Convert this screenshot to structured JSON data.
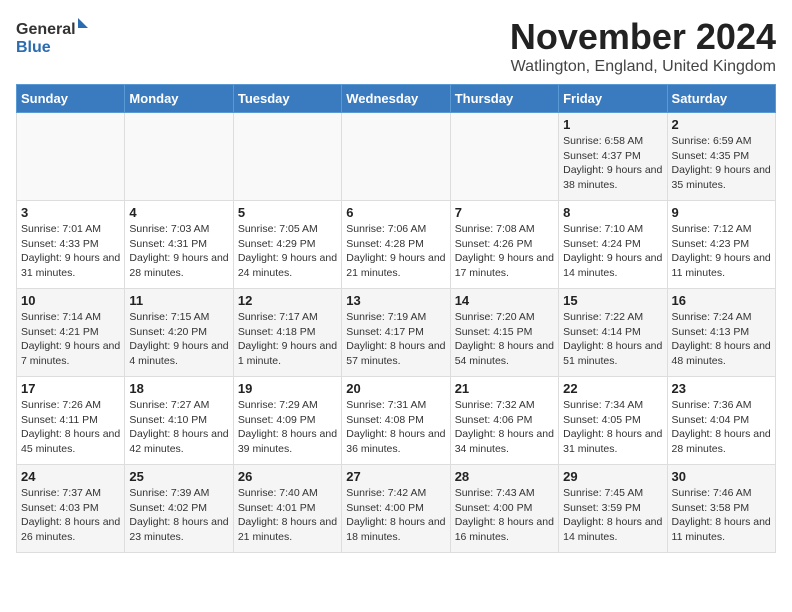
{
  "header": {
    "logo_general": "General",
    "logo_blue": "Blue",
    "month_title": "November 2024",
    "location": "Watlington, England, United Kingdom"
  },
  "days_of_week": [
    "Sunday",
    "Monday",
    "Tuesday",
    "Wednesday",
    "Thursday",
    "Friday",
    "Saturday"
  ],
  "weeks": [
    [
      {
        "day": "",
        "info": ""
      },
      {
        "day": "",
        "info": ""
      },
      {
        "day": "",
        "info": ""
      },
      {
        "day": "",
        "info": ""
      },
      {
        "day": "",
        "info": ""
      },
      {
        "day": "1",
        "info": "Sunrise: 6:58 AM\nSunset: 4:37 PM\nDaylight: 9 hours and 38 minutes."
      },
      {
        "day": "2",
        "info": "Sunrise: 6:59 AM\nSunset: 4:35 PM\nDaylight: 9 hours and 35 minutes."
      }
    ],
    [
      {
        "day": "3",
        "info": "Sunrise: 7:01 AM\nSunset: 4:33 PM\nDaylight: 9 hours and 31 minutes."
      },
      {
        "day": "4",
        "info": "Sunrise: 7:03 AM\nSunset: 4:31 PM\nDaylight: 9 hours and 28 minutes."
      },
      {
        "day": "5",
        "info": "Sunrise: 7:05 AM\nSunset: 4:29 PM\nDaylight: 9 hours and 24 minutes."
      },
      {
        "day": "6",
        "info": "Sunrise: 7:06 AM\nSunset: 4:28 PM\nDaylight: 9 hours and 21 minutes."
      },
      {
        "day": "7",
        "info": "Sunrise: 7:08 AM\nSunset: 4:26 PM\nDaylight: 9 hours and 17 minutes."
      },
      {
        "day": "8",
        "info": "Sunrise: 7:10 AM\nSunset: 4:24 PM\nDaylight: 9 hours and 14 minutes."
      },
      {
        "day": "9",
        "info": "Sunrise: 7:12 AM\nSunset: 4:23 PM\nDaylight: 9 hours and 11 minutes."
      }
    ],
    [
      {
        "day": "10",
        "info": "Sunrise: 7:14 AM\nSunset: 4:21 PM\nDaylight: 9 hours and 7 minutes."
      },
      {
        "day": "11",
        "info": "Sunrise: 7:15 AM\nSunset: 4:20 PM\nDaylight: 9 hours and 4 minutes."
      },
      {
        "day": "12",
        "info": "Sunrise: 7:17 AM\nSunset: 4:18 PM\nDaylight: 9 hours and 1 minute."
      },
      {
        "day": "13",
        "info": "Sunrise: 7:19 AM\nSunset: 4:17 PM\nDaylight: 8 hours and 57 minutes."
      },
      {
        "day": "14",
        "info": "Sunrise: 7:20 AM\nSunset: 4:15 PM\nDaylight: 8 hours and 54 minutes."
      },
      {
        "day": "15",
        "info": "Sunrise: 7:22 AM\nSunset: 4:14 PM\nDaylight: 8 hours and 51 minutes."
      },
      {
        "day": "16",
        "info": "Sunrise: 7:24 AM\nSunset: 4:13 PM\nDaylight: 8 hours and 48 minutes."
      }
    ],
    [
      {
        "day": "17",
        "info": "Sunrise: 7:26 AM\nSunset: 4:11 PM\nDaylight: 8 hours and 45 minutes."
      },
      {
        "day": "18",
        "info": "Sunrise: 7:27 AM\nSunset: 4:10 PM\nDaylight: 8 hours and 42 minutes."
      },
      {
        "day": "19",
        "info": "Sunrise: 7:29 AM\nSunset: 4:09 PM\nDaylight: 8 hours and 39 minutes."
      },
      {
        "day": "20",
        "info": "Sunrise: 7:31 AM\nSunset: 4:08 PM\nDaylight: 8 hours and 36 minutes."
      },
      {
        "day": "21",
        "info": "Sunrise: 7:32 AM\nSunset: 4:06 PM\nDaylight: 8 hours and 34 minutes."
      },
      {
        "day": "22",
        "info": "Sunrise: 7:34 AM\nSunset: 4:05 PM\nDaylight: 8 hours and 31 minutes."
      },
      {
        "day": "23",
        "info": "Sunrise: 7:36 AM\nSunset: 4:04 PM\nDaylight: 8 hours and 28 minutes."
      }
    ],
    [
      {
        "day": "24",
        "info": "Sunrise: 7:37 AM\nSunset: 4:03 PM\nDaylight: 8 hours and 26 minutes."
      },
      {
        "day": "25",
        "info": "Sunrise: 7:39 AM\nSunset: 4:02 PM\nDaylight: 8 hours and 23 minutes."
      },
      {
        "day": "26",
        "info": "Sunrise: 7:40 AM\nSunset: 4:01 PM\nDaylight: 8 hours and 21 minutes."
      },
      {
        "day": "27",
        "info": "Sunrise: 7:42 AM\nSunset: 4:00 PM\nDaylight: 8 hours and 18 minutes."
      },
      {
        "day": "28",
        "info": "Sunrise: 7:43 AM\nSunset: 4:00 PM\nDaylight: 8 hours and 16 minutes."
      },
      {
        "day": "29",
        "info": "Sunrise: 7:45 AM\nSunset: 3:59 PM\nDaylight: 8 hours and 14 minutes."
      },
      {
        "day": "30",
        "info": "Sunrise: 7:46 AM\nSunset: 3:58 PM\nDaylight: 8 hours and 11 minutes."
      }
    ]
  ]
}
